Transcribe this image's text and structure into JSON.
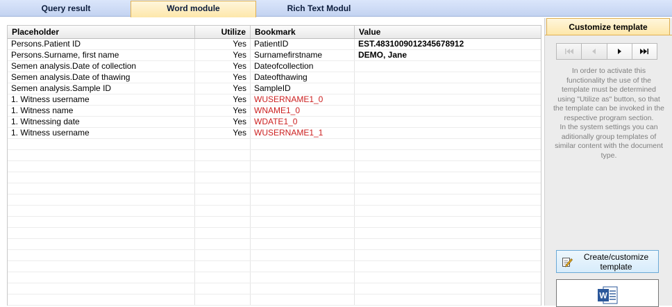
{
  "tabs": [
    {
      "label": "Query result",
      "active": false
    },
    {
      "label": "Word module",
      "active": true
    },
    {
      "label": "Rich Text Modul",
      "active": false
    }
  ],
  "grid": {
    "columns": [
      "Placeholder",
      "Utilize",
      "Bookmark",
      "Value"
    ],
    "rows": [
      {
        "placeholder": "Persons.Patient ID",
        "utilize": "Yes",
        "bookmark": "PatientID",
        "value": "EST.4831009012345678912",
        "bookmark_red": false
      },
      {
        "placeholder": "Persons.Surname, first name",
        "utilize": "Yes",
        "bookmark": "Surnamefirstname",
        "value": "DEMO, Jane",
        "bookmark_red": false
      },
      {
        "placeholder": "Semen analysis.Date of collection",
        "utilize": "Yes",
        "bookmark": "Dateofcollection",
        "value": "",
        "bookmark_red": false
      },
      {
        "placeholder": "Semen analysis.Date of thawing",
        "utilize": "Yes",
        "bookmark": "Dateofthawing",
        "value": "",
        "bookmark_red": false
      },
      {
        "placeholder": "Semen analysis.Sample ID",
        "utilize": "Yes",
        "bookmark": "SampleID",
        "value": "",
        "bookmark_red": false
      },
      {
        "placeholder": "1. Witness username",
        "utilize": "Yes",
        "bookmark": "WUSERNAME1_0",
        "value": "",
        "bookmark_red": true
      },
      {
        "placeholder": "1. Witness name",
        "utilize": "Yes",
        "bookmark": "WNAME1_0",
        "value": "",
        "bookmark_red": true
      },
      {
        "placeholder": "1. Witnessing date",
        "utilize": "Yes",
        "bookmark": "WDATE1_0",
        "value": "",
        "bookmark_red": true
      },
      {
        "placeholder": "1. Witness username",
        "utilize": "Yes",
        "bookmark": "WUSERNAME1_1",
        "value": "",
        "bookmark_red": true
      }
    ]
  },
  "side": {
    "title": "Customize template",
    "info_lines": [
      "In order to activate this",
      "functionality the use of the",
      "template must be determined",
      "using \"Utilize as\" button, so that",
      "the template can be invoked in the",
      "respective program section.",
      "In the system settings you can",
      "aditionally group templates of",
      "similar content with the document",
      "type."
    ],
    "create_label_1": "Create/customize",
    "create_label_2": "template",
    "word_icon": "W"
  },
  "colors": {
    "active_tab": "#fde7aa",
    "bookmark_red": "#cc1f1f",
    "word_blue": "#2b579a"
  }
}
